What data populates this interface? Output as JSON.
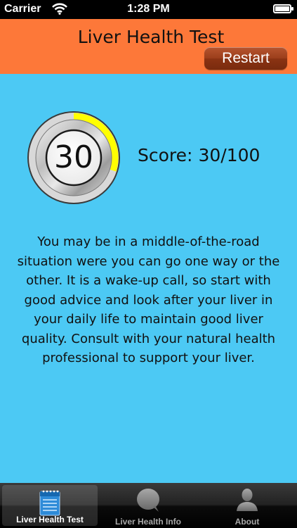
{
  "status_bar": {
    "carrier": "Carrier",
    "time": "1:28 PM"
  },
  "header": {
    "title": "Liver Health Test",
    "restart_label": "Restart",
    "background_color": "#fd7839"
  },
  "result": {
    "gauge_value": "30",
    "score_label": "Score:",
    "score_text": "30/100",
    "score_fraction": 0.3,
    "gauge_arc_color": "#ffff00"
  },
  "description": "You may be in a middle-of-the-road situation were you can go one way or the other. It is a wake-up call, so start with good advice and look after your liver in your daily life to maintain good liver quality. Consult with your natural health professional to support your liver.",
  "tab_bar": {
    "tabs": [
      {
        "label": "Liver Health Test",
        "icon": "notepad-icon",
        "active": true
      },
      {
        "label": "Liver Health Info",
        "icon": "speech-bubble-icon",
        "active": false
      },
      {
        "label": "About",
        "icon": "person-icon",
        "active": false
      }
    ]
  },
  "colors": {
    "page_background": "#4cc9f4"
  }
}
